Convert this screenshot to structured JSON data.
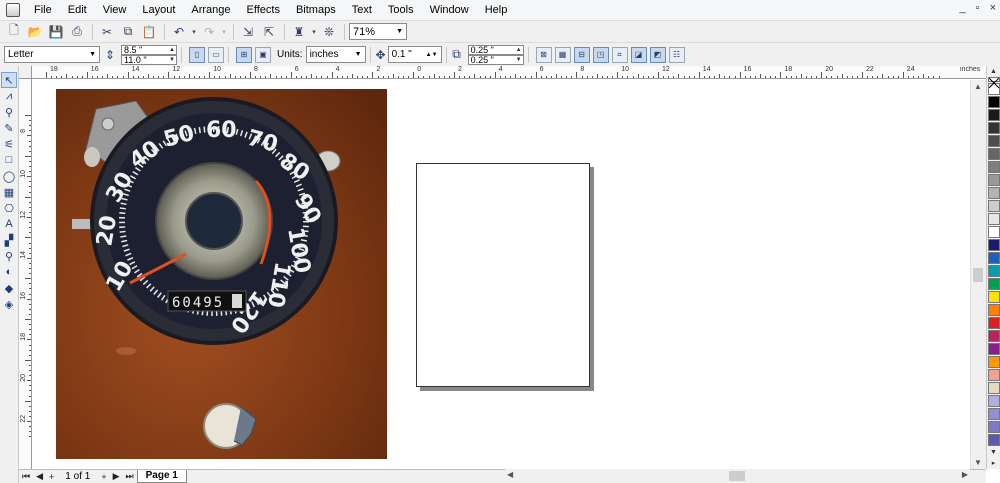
{
  "menu": {
    "items": [
      "File",
      "Edit",
      "View",
      "Layout",
      "Arrange",
      "Effects",
      "Bitmaps",
      "Text",
      "Tools",
      "Window",
      "Help"
    ],
    "window_controls": [
      "_",
      "▫",
      "×"
    ]
  },
  "toolbar": {
    "zoom_value": "71%"
  },
  "property_bar": {
    "paper_size": "Letter",
    "page_width": "8.5 \"",
    "page_height": "11.0 \"",
    "units_label": "Units:",
    "units_value": "inches",
    "nudge_value": "0.1 \"",
    "duplicate_x": "0.25 \"",
    "duplicate_y": "0.25 \""
  },
  "ruler": {
    "h_labels": [
      "18",
      "16",
      "14",
      "12",
      "10",
      "8",
      "6",
      "4",
      "2",
      "0",
      "2",
      "4",
      "6",
      "8",
      "10",
      "12",
      "14",
      "16",
      "18",
      "20",
      "22",
      "24"
    ],
    "unit": "inches",
    "v_labels": [
      "8",
      "10",
      "12",
      "14",
      "16",
      "18",
      "20",
      "22"
    ]
  },
  "photo": {
    "odometer": "60495",
    "dial_numbers": [
      "10",
      "20",
      "30",
      "40",
      "50",
      "60",
      "70",
      "80",
      "90",
      "100",
      "110",
      "120"
    ]
  },
  "page_nav": {
    "page_count": "1 of 1",
    "page_tab": "Page 1"
  },
  "palette": [
    "#ffffff",
    "#000000",
    "#1a1a1a",
    "#333333",
    "#4d4d4d",
    "#666666",
    "#808080",
    "#999999",
    "#b3b3b3",
    "#cccccc",
    "#e6e6e6",
    "#ffffff",
    "#1a1a6e",
    "#1f5fbf",
    "#00a0b0",
    "#00a050",
    "#ffe000",
    "#ff8000",
    "#e02020",
    "#c02060",
    "#8a2090",
    "#ff9900",
    "#f4a090",
    "#e8d8c0",
    "#b0b0e0",
    "#9090d0",
    "#7a7ac8",
    "#5a5ab0"
  ],
  "colors": {
    "accent": "#1e3c78",
    "page_shadow": "#888888",
    "photo_brown": "#7a3612"
  }
}
